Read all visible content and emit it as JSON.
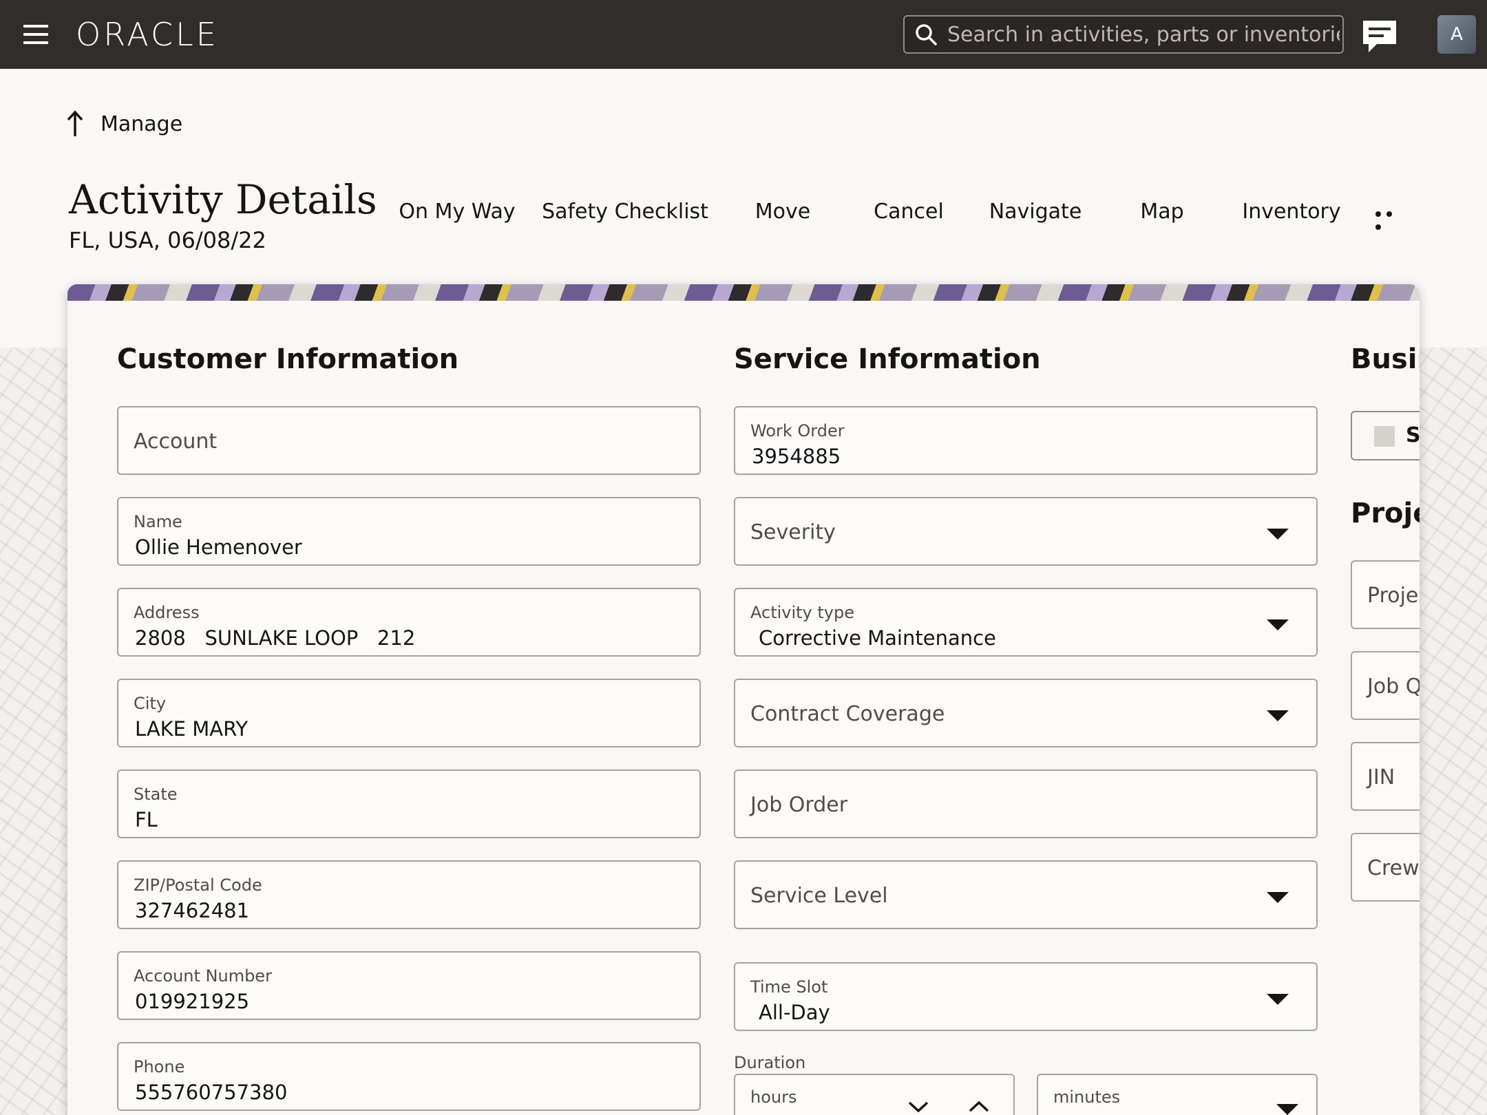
{
  "header": {
    "logo": "ORACLE",
    "search_placeholder": "Search in activities, parts or inventories",
    "avatar_initial": "A"
  },
  "breadcrumb": {
    "label": "Manage"
  },
  "page": {
    "title": "Activity Details",
    "subtitle": "FL, USA, 06/08/22"
  },
  "actions": [
    "On My Way",
    "Safety Checklist",
    "Move",
    "Cancel",
    "Navigate",
    "Map",
    "Inventory"
  ],
  "customer": {
    "title": "Customer Information",
    "account_placeholder": "Account",
    "name_label": "Name",
    "name_value": "Ollie Hemenover",
    "address_label": "Address",
    "address_value": "2808   SUNLAKE LOOP   212",
    "city_label": "City",
    "city_value": "LAKE MARY",
    "state_label": "State",
    "state_value": "FL",
    "zip_label": "ZIP/Postal Code",
    "zip_value": "327462481",
    "account_number_label": "Account Number",
    "account_number_value": "019921925",
    "phone_label": "Phone",
    "phone_value": "555760757380"
  },
  "service": {
    "title": "Service Information",
    "work_order_label": "Work Order",
    "work_order_value": "3954885",
    "severity_placeholder": "Severity",
    "activity_type_label": "Activity type",
    "activity_type_value": "Corrective Maintenance",
    "contract_coverage_placeholder": "Contract Coverage",
    "job_order_placeholder": "Job Order",
    "service_level_placeholder": "Service Level",
    "time_slot_label": "Time Slot",
    "time_slot_value": "All-Day",
    "duration_label": "Duration",
    "hours_label": "hours",
    "minutes_label": "minutes"
  },
  "business": {
    "title": "Busir",
    "checkbox_label": "Sa",
    "project_title": "Proje",
    "project_placeholder": "Projec",
    "job_q_placeholder": "Job Q",
    "jin_placeholder": "JIN",
    "crew_placeholder": "Crew S"
  }
}
